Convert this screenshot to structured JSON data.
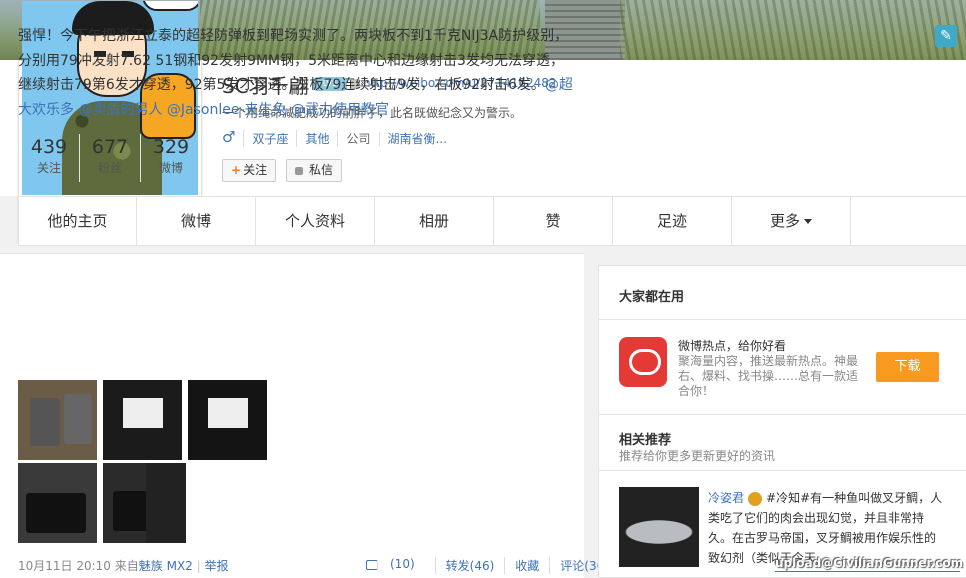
{
  "profile": {
    "name": "SC羽千翩",
    "url": "http://weibo.com/u/2714162482",
    "bio": "一个用绳命减肥成功的前胖子，此名既做纪念又为警示。",
    "gender_symbol": "♂",
    "zodiac": "双子座",
    "location": "其他",
    "company_label": "公司",
    "company": "湖南省衡...",
    "follow_label": "关注",
    "message_label": "私信",
    "stats": [
      {
        "num": "439",
        "label": "关注"
      },
      {
        "num": "677",
        "label": "粉丝"
      },
      {
        "num": "329",
        "label": "微博"
      }
    ]
  },
  "nav": {
    "tabs": [
      "他的主页",
      "微博",
      "个人资料",
      "相册",
      "赞",
      "足迹",
      "更多"
    ]
  },
  "post": {
    "text": "强悍！今下午把浙江立泰的超轻防弹板到靶场实测了。两块板不到1千克NIJ3A防护级别，分别用79冲发射7.62 51钢和92发射9MM钢，5米距离中心和边缘射击3发均无法穿透，继续射击79第6发才穿透，92第5发才穿透。左板79连续射击9发，右板92射击6发。",
    "mentions": "@超大欢乐多 @卖盾的男人 @Jasonlee-夹生兔 @武力使用教官",
    "time": "10月11日 20:10",
    "from_label": "来自",
    "source": "魅族 MX2",
    "report": "举报",
    "like": "(10)",
    "forward": "转发(46)",
    "favorite": "收藏",
    "comment": "评论(36)"
  },
  "sidebar": {
    "hot_header": "大家都在用",
    "hot_title": "微博热点，给你好看",
    "hot_desc": "聚海量内容，推送最新热点。神最右、爆料、找书操……总有一款适合你！",
    "download": "下载",
    "rec_header": "相关推荐",
    "rec_sub": "推荐给你更多更新更好的资讯",
    "rec_name": "冷姿君",
    "rec_text": "#冷知#有一种鱼叫做叉牙鲷，人类吃了它们的肉会出现幻觉，并且非常持久。在古罗马帝国，叉牙鲷被用作娱乐性的致幻剂（类似于今天"
  },
  "watermark": "upload@CivilianGunner.com"
}
